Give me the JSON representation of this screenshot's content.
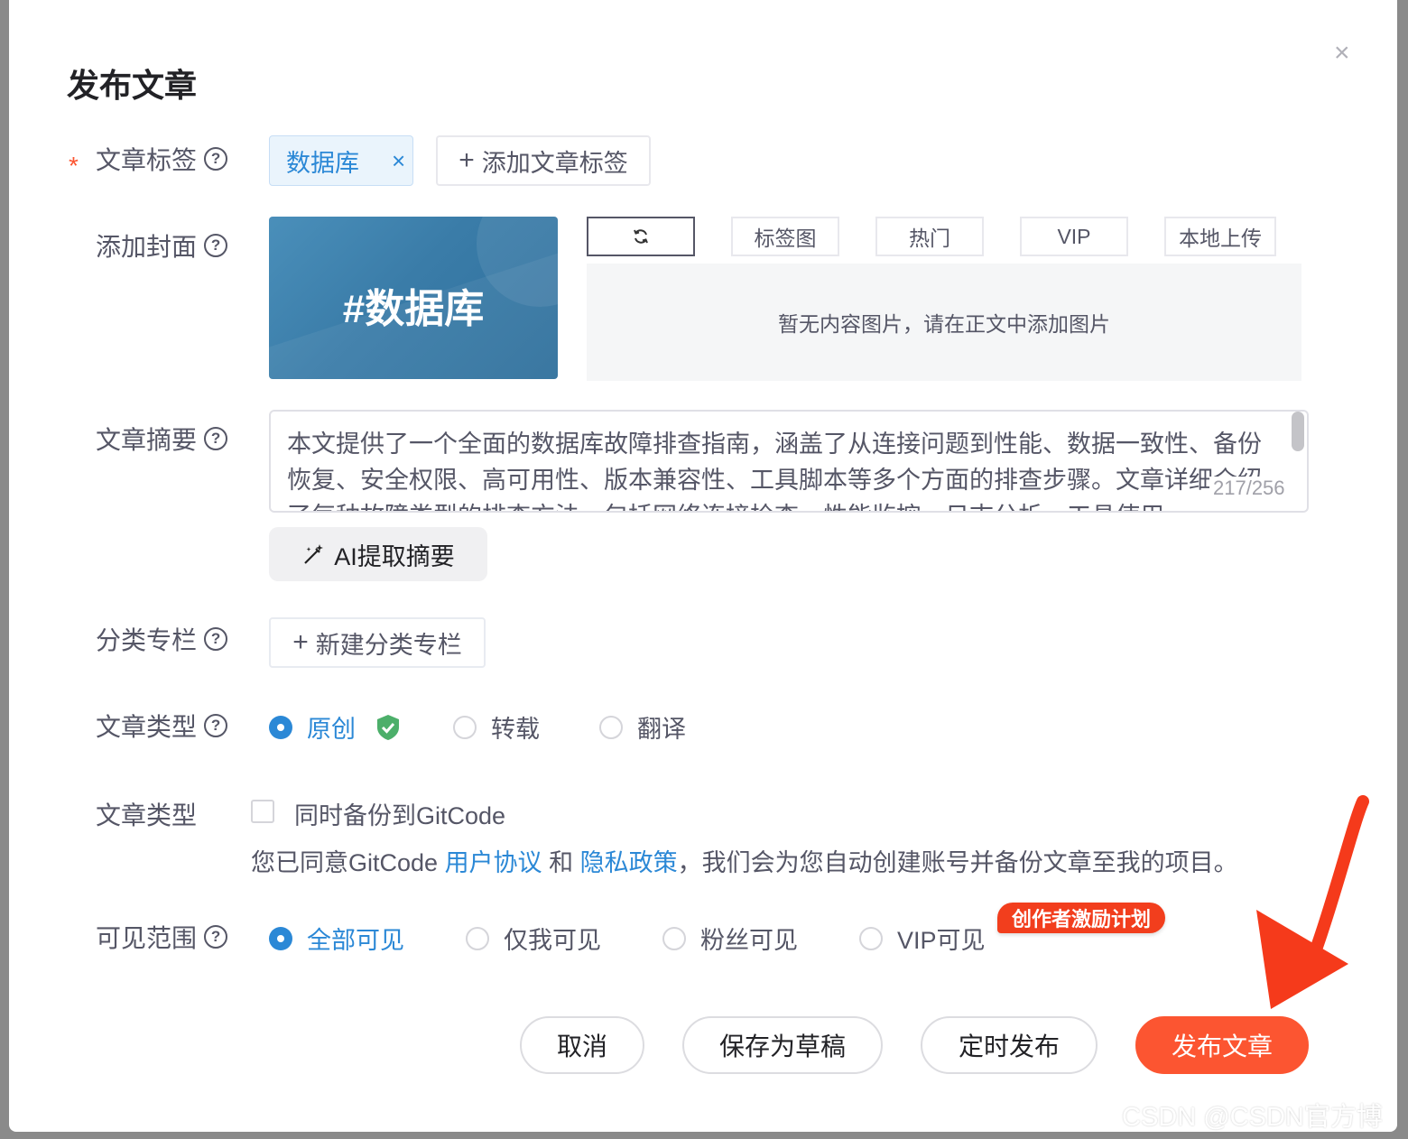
{
  "dialog": {
    "title": "发布文章",
    "close_icon": "close-icon"
  },
  "tags": {
    "label": "文章标签",
    "required_mark": "*",
    "items": [
      {
        "label": "数据库",
        "remove": "×"
      }
    ],
    "add_label": "添加文章标签"
  },
  "cover": {
    "label": "添加封面",
    "preview_text": "#数据库",
    "tabs": [
      {
        "label": "",
        "icon": "refresh-icon"
      },
      {
        "label": "标签图"
      },
      {
        "label": "热门"
      },
      {
        "label": "VIP"
      },
      {
        "label": "本地上传"
      }
    ],
    "empty_text": "暂无内容图片，请在正文中添加图片"
  },
  "summary": {
    "label": "文章摘要",
    "text": "本文提供了一个全面的数据库故障排查指南，涵盖了从连接问题到性能、数据一致性、备份恢复、安全权限、高可用性、版本兼容性、工具脚本等多个方面的排查步骤。文章详细介绍了每种故障类型的排查方法，包括网络连接检查、性能监控、日志分析、工具使用",
    "counter": "217/256",
    "ai_button": "AI提取摘要"
  },
  "column": {
    "label": "分类专栏",
    "new_button": "新建分类专栏"
  },
  "article_type": {
    "label": "文章类型",
    "options": [
      "原创",
      "转载",
      "翻译"
    ],
    "selected": "原创"
  },
  "gitcode": {
    "label": "文章类型",
    "checkbox_label": "同时备份到GitCode",
    "checked": false,
    "agree_prefix": "您已同意GitCode ",
    "user_agreement": "用户协议",
    "and": " 和 ",
    "privacy_policy": "隐私政策",
    "agree_suffix": "，我们会为您自动创建账号并备份文章至我的项目。"
  },
  "visibility": {
    "label": "可见范围",
    "options": [
      "全部可见",
      "仅我可见",
      "粉丝可见",
      "VIP可见"
    ],
    "selected": "全部可见",
    "badge": "创作者激励计划"
  },
  "actions": {
    "cancel": "取消",
    "save_draft": "保存为草稿",
    "schedule": "定时发布",
    "publish": "发布文章"
  },
  "watermark": "CSDN @CSDN官方博客",
  "colors": {
    "accent_blue": "#2b88d6",
    "primary_orange": "#fc5531",
    "annotation_red": "#f53a1b",
    "verified_green": "#4caf6a"
  }
}
